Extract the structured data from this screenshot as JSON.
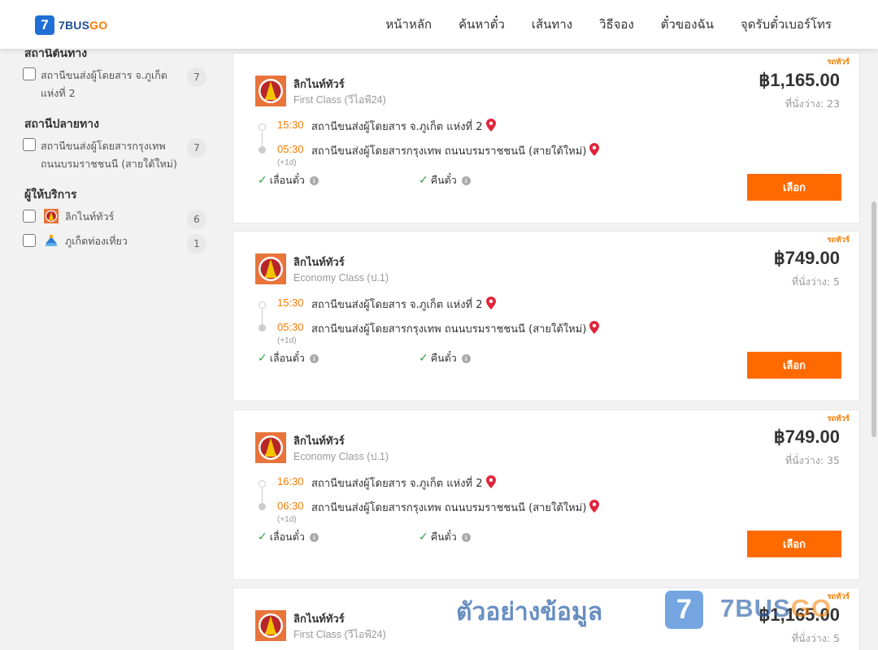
{
  "brand": {
    "logo_mark": "7",
    "name_part1": "7BUS",
    "name_part2": "GO"
  },
  "nav": [
    "หน้าหลัก",
    "ค้นหาตั๋ว",
    "เส้นทาง",
    "วิธีจอง",
    "ตั๋วของฉัน",
    "จุดรับตั๋วเบอร์โทร"
  ],
  "sidebar": {
    "origin_title": "สถานีต้นทาง",
    "origin_items": [
      {
        "label": "สถานีขนส่งผู้โดยสาร จ.ภูเก็ต แห่งที่ 2",
        "count": "7"
      }
    ],
    "destination_title": "สถานีปลายทาง",
    "destination_items": [
      {
        "label": "สถานีขนส่งผู้โดยสารกรุงเทพ ถนนบรมราชชนนี (สายใต้ใหม่)",
        "count": "7"
      }
    ],
    "operator_title": "ผู้ให้บริการ",
    "operator_items": [
      {
        "label": "ลิกไนท์ทัวร์",
        "count": "6"
      },
      {
        "label": "ภูเก็ตท่องเที่ยว",
        "count": "1"
      }
    ]
  },
  "trips": [
    {
      "badge": "รถทัวร์",
      "operator": "ลิกไนท์ทัวร์",
      "bus_class": "First Class (วีไอพี24)",
      "price": "฿1,165.00",
      "seats": "ที่นั่งว่าง: 23",
      "dep_time": "15:30",
      "dep_station": "สถานีขนส่งผู้โดยสาร จ.ภูเก็ต แห่งที่ 2",
      "arr_time": "05:30",
      "arr_station": "สถานีขนส่งผู้โดยสารกรุงเทพ ถนนบรมราชชนนี (สายใต้ใหม่)",
      "day_offset": "(+1d)",
      "feature1": "เลื่อนตั๋ว",
      "feature2": "คืนตั๋ว",
      "select_label": "เลือก"
    },
    {
      "badge": "รถทัวร์",
      "operator": "ลิกไนท์ทัวร์",
      "bus_class": "Economy Class (ป.1)",
      "price": "฿749.00",
      "seats": "ที่นั่งว่าง: 5",
      "dep_time": "15:30",
      "dep_station": "สถานีขนส่งผู้โดยสาร จ.ภูเก็ต แห่งที่ 2",
      "arr_time": "05:30",
      "arr_station": "สถานีขนส่งผู้โดยสารกรุงเทพ ถนนบรมราชชนนี (สายใต้ใหม่)",
      "day_offset": "(+1d)",
      "feature1": "เลื่อนตั๋ว",
      "feature2": "คืนตั๋ว",
      "select_label": "เลือก"
    },
    {
      "badge": "รถทัวร์",
      "operator": "ลิกไนท์ทัวร์",
      "bus_class": "Economy Class (ป.1)",
      "price": "฿749.00",
      "seats": "ที่นั่งว่าง: 35",
      "dep_time": "16:30",
      "dep_station": "สถานีขนส่งผู้โดยสาร จ.ภูเก็ต แห่งที่ 2",
      "arr_time": "06:30",
      "arr_station": "สถานีขนส่งผู้โดยสารกรุงเทพ ถนนบรมราชชนนี (สายใต้ใหม่)",
      "day_offset": "(+1d)",
      "feature1": "เลื่อนตั๋ว",
      "feature2": "คืนตั๋ว",
      "select_label": "เลือก"
    },
    {
      "badge": "รถทัวร์",
      "operator": "ลิกไนท์ทัวร์",
      "bus_class": "First Class (วีไอพี24)",
      "price": "฿1,165.00",
      "seats": "ที่นั่งว่าง: 5"
    }
  ],
  "watermark": {
    "text": "ตัวอย่างข้อมูล",
    "mark": "7",
    "brand_part1": "7BUS",
    "brand_part2": "GO"
  },
  "colors": {
    "accent": "#ff6a00",
    "time": "#f57c00",
    "check": "#2e9e3e",
    "brand_blue": "#1f4e96"
  },
  "icons": {
    "location": "map-pin-icon",
    "check": "check-icon",
    "info": "info-icon",
    "operator_logo": "lignite-tour-logo"
  }
}
